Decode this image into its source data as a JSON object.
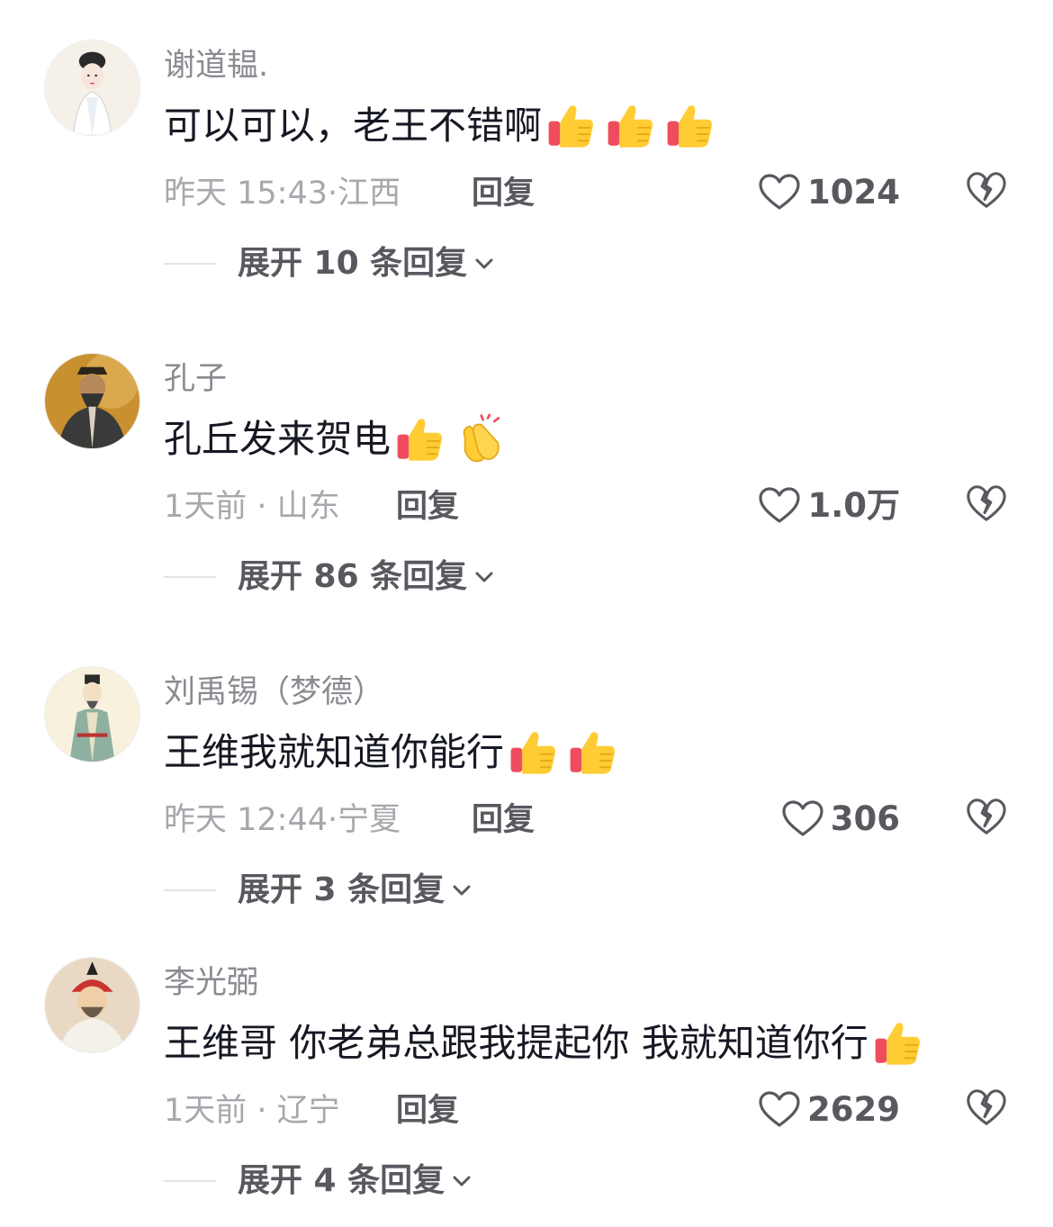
{
  "comments": [
    {
      "username": "谢道韫.",
      "text": "可以可以，老王不错啊",
      "emojis": [
        "thumbs-up",
        "thumbs-up",
        "thumbs-up"
      ],
      "time": "昨天 15:43",
      "separator": "·",
      "location": "江西",
      "reply_label": "回复",
      "likes": "1024",
      "expand_label": "展开 10 条回复",
      "avatar_icon": "woman-portrait-icon"
    },
    {
      "username": "孔子",
      "text": "孔丘发来贺电",
      "emojis": [
        "thumbs-up",
        "clapping-hands"
      ],
      "time": "1天前",
      "separator": "·",
      "location": "山东",
      "reply_label": "回复",
      "likes": "1.0万",
      "expand_label": "展开 86 条回复",
      "avatar_icon": "confucius-portrait-icon"
    },
    {
      "username": "刘禹锡（梦德）",
      "text": "王维我就知道你能行",
      "emojis": [
        "thumbs-up",
        "thumbs-up"
      ],
      "time": "昨天 12:44",
      "separator": "·",
      "location": "宁夏",
      "reply_label": "回复",
      "likes": "306",
      "expand_label": "展开 3 条回复",
      "avatar_icon": "scholar-portrait-icon"
    },
    {
      "username": "李光弼",
      "text": "王维哥 你老弟总跟我提起你 我就知道你行",
      "emojis": [
        "thumbs-up"
      ],
      "time": "1天前",
      "separator": "·",
      "location": "辽宁",
      "reply_label": "回复",
      "likes": "2629",
      "expand_label": "展开 4 条回复",
      "avatar_icon": "general-portrait-icon"
    }
  ],
  "colors": {
    "username": "#8a8b91",
    "content": "#161823",
    "meta": "#a7a8ad",
    "action": "#58595f"
  }
}
